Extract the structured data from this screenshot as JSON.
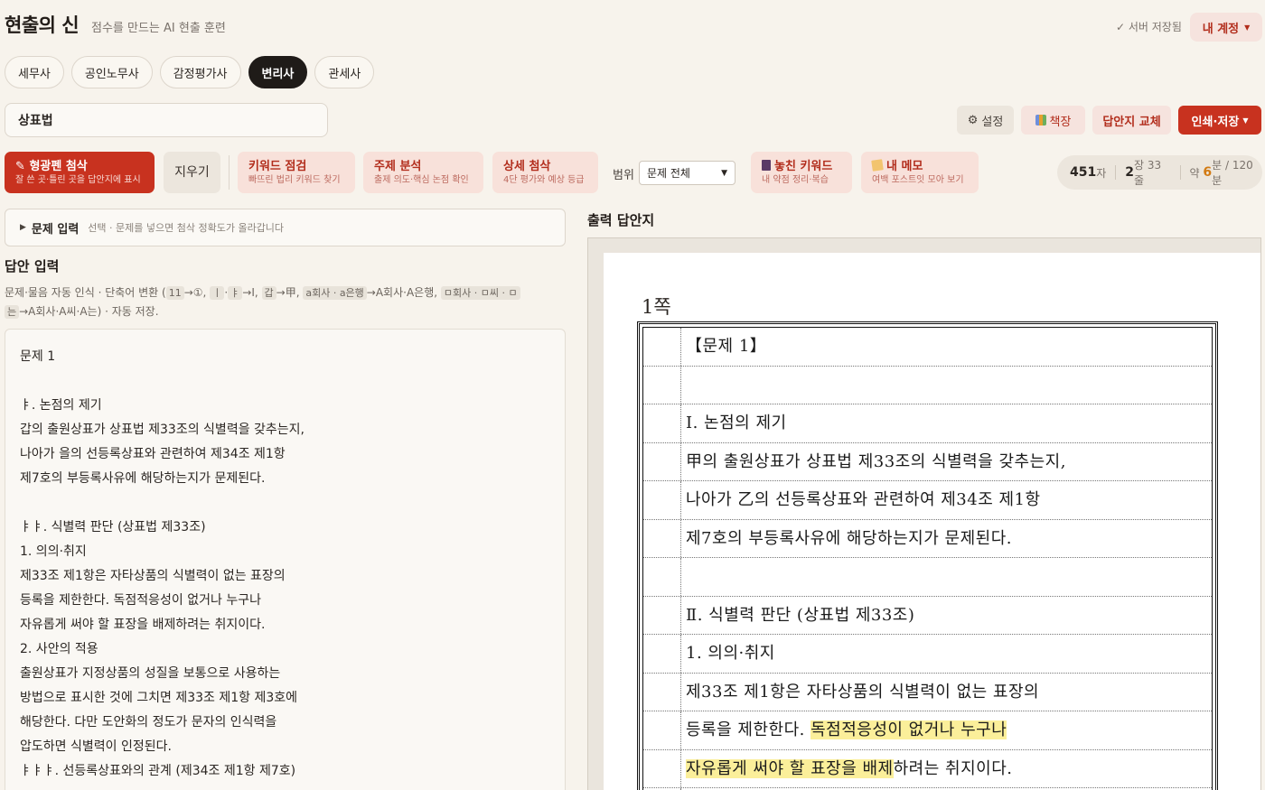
{
  "header": {
    "brand": "현출의 신",
    "subtitle": "점수를 만드는 AI 현출 훈련",
    "saved_status": "✓ 서버 저장됨",
    "account_label": "내 계정"
  },
  "tabs": [
    "세무사",
    "공인노무사",
    "감정평가사",
    "변리사",
    "관세사"
  ],
  "active_tab": "변리사",
  "subject_value": "상표법",
  "actions": {
    "settings": "설정",
    "shelf": "책장",
    "swap": "답안지 교체",
    "print": "인쇄·저장"
  },
  "toolbar": {
    "highlight": {
      "title": "형광펜 첨삭",
      "desc": "잘 쓴 곳·틀린 곳을 답안지에 표시"
    },
    "clear": "지우기",
    "keyword": {
      "title": "키워드 점검",
      "desc": "빠뜨린 법리 키워드 찾기"
    },
    "topic": {
      "title": "주제 분석",
      "desc": "출제 의도·핵심 논점 확인"
    },
    "detail": {
      "title": "상세 첨삭",
      "desc": "4단 평가와 예상 등급"
    },
    "scope_label": "범위",
    "scope_value": "문제 전체",
    "missed": {
      "title": "놓친 키워드",
      "desc": "내 약점 정리·복습"
    },
    "memo": {
      "title": "내 메모",
      "desc": "여백 포스트잇 모아 보기"
    }
  },
  "stats": {
    "chars": "451",
    "chars_unit": "자",
    "pages": "2",
    "pages_unit": "장 33줄",
    "time_prefix": "약",
    "minutes": "6",
    "time_suffix": "분 / 120분"
  },
  "question_input": {
    "label": "문제 입력",
    "hint": "선택 · 문제를 넣으면 첨삭 정확도가 올라갑니다"
  },
  "answer": {
    "title": "답안 입력",
    "desc_prefix": "문제·물음 자동 인식 · 단축어 변환 (",
    "chip1": "11",
    "arrow1": "→①,",
    "chip2": "ㅣ",
    "chip2b": "ㅑ",
    "arrow2": "→Ⅰ,",
    "chip3": "갑",
    "arrow3": "→甲,",
    "chip4": "a회사 · a은행",
    "arrow4": "→A회사·A은행,",
    "chip5": "ㅁ회사 · ㅁ씨 · ㅁ",
    "chip5b": "는",
    "desc_suffix": "→A회사·A씨·A는) · 자동 저장.",
    "lines": [
      "문제 1",
      "",
      "ㅑ. 논점의 제기",
      "갑의 출원상표가 상표법 제33조의 식별력을 갖추는지,",
      "나아가 을의 선등록상표와 관련하여 제34조 제1항",
      "제7호의 부등록사유에 해당하는지가 문제된다.",
      "",
      "ㅑㅑ. 식별력 판단 (상표법 제33조)",
      "1. 의의·취지",
      "제33조 제1항은 자타상품의 식별력이 없는 표장의",
      "등록을 제한한다. 독점적응성이 없거나 누구나",
      "자유롭게 써야 할 표장을 배제하려는 취지이다.",
      "2. 사안의 적용",
      "출원상표가 지정상품의 성질을 보통으로 사용하는",
      "방법으로 표시한 것에 그치면 제33조 제1항 제3호에",
      "해당한다. 다만 도안화의 정도가 문자의 인식력을",
      "압도하면 식별력이 인정된다.",
      "ㅑㅑㅑ. 선등록상표와의 관계 (제34조 제1항 제7호)"
    ]
  },
  "output": {
    "title": "출력 답안지",
    "page_label": "1쪽",
    "rows": [
      {
        "pre": "【문제 1】",
        "hl": "",
        "post": ""
      },
      {
        "pre": "",
        "hl": "",
        "post": ""
      },
      {
        "pre": "Ⅰ. 논점의 제기",
        "hl": "",
        "post": ""
      },
      {
        "pre": "甲의 출원상표가 상표법 제33조의 식별력을 갖추는지,",
        "hl": "",
        "post": ""
      },
      {
        "pre": "나아가 乙의 선등록상표와 관련하여 제34조 제1항",
        "hl": "",
        "post": ""
      },
      {
        "pre": "제7호의 부등록사유에 해당하는지가 문제된다.",
        "hl": "",
        "post": ""
      },
      {
        "pre": "",
        "hl": "",
        "post": ""
      },
      {
        "pre": "Ⅱ. 식별력 판단 (상표법 제33조)",
        "hl": "",
        "post": ""
      },
      {
        "pre": "1. 의의·취지",
        "hl": "",
        "post": ""
      },
      {
        "pre": "제33조 제1항은 자타상품의 식별력이 없는 표장의",
        "hl": "",
        "post": ""
      },
      {
        "pre": "등록을 제한한다. ",
        "hl": "독점적응성이 없거나 누구나",
        "post": ""
      },
      {
        "pre": "",
        "hl": "자유롭게 써야 할 표장을 배제",
        "post": "하려는 취지이다."
      },
      {
        "pre": "",
        "hl": "",
        "post": ""
      }
    ]
  },
  "colors": {
    "accent": "#c8321f",
    "accent_soft": "#f6e3de",
    "background": "#f7f3ec",
    "highlight": "#fbef9a",
    "time_accent": "#d27a12"
  },
  "icons": {
    "saved": "check-icon",
    "settings": "gear-icon",
    "shelf": "books-icon",
    "highlight": "pencil-icon",
    "missed": "notebook-icon",
    "memo": "sticky-note-icon"
  }
}
